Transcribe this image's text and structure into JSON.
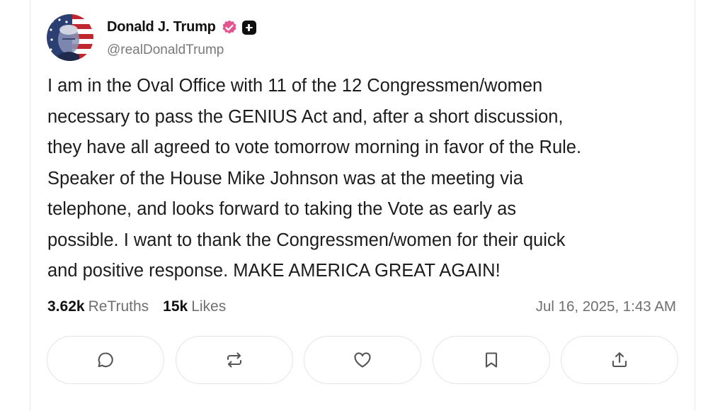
{
  "post": {
    "author": {
      "name": "Donald J. Trump",
      "handle": "@realDonaldTrump",
      "verified_color": "#e2558f"
    },
    "text": "I am in the Oval Office with 11 of the 12 Congressmen/women\nnecessary to pass the GENIUS Act and, after a short discussion,\nthey have all agreed to vote tomorrow morning in favor of the Rule.\nSpeaker of the House Mike Johnson was at the meeting via\ntelephone, and looks forward to taking the Vote as early as\npossible. I want to thank the Congressmen/women for their quick\nand positive response. MAKE AMERICA GREAT AGAIN!",
    "stats": {
      "retruths_count": "3.62k",
      "retruths_label": "ReTruths",
      "likes_count": "15k",
      "likes_label": "Likes",
      "timestamp": "Jul 16, 2025, 1:43 AM"
    }
  },
  "actions": [
    {
      "name": "reply",
      "icon": "comment-icon"
    },
    {
      "name": "retruth",
      "icon": "repost-icon"
    },
    {
      "name": "like",
      "icon": "heart-icon"
    },
    {
      "name": "bookmark",
      "icon": "bookmark-icon"
    },
    {
      "name": "share",
      "icon": "share-icon"
    }
  ]
}
